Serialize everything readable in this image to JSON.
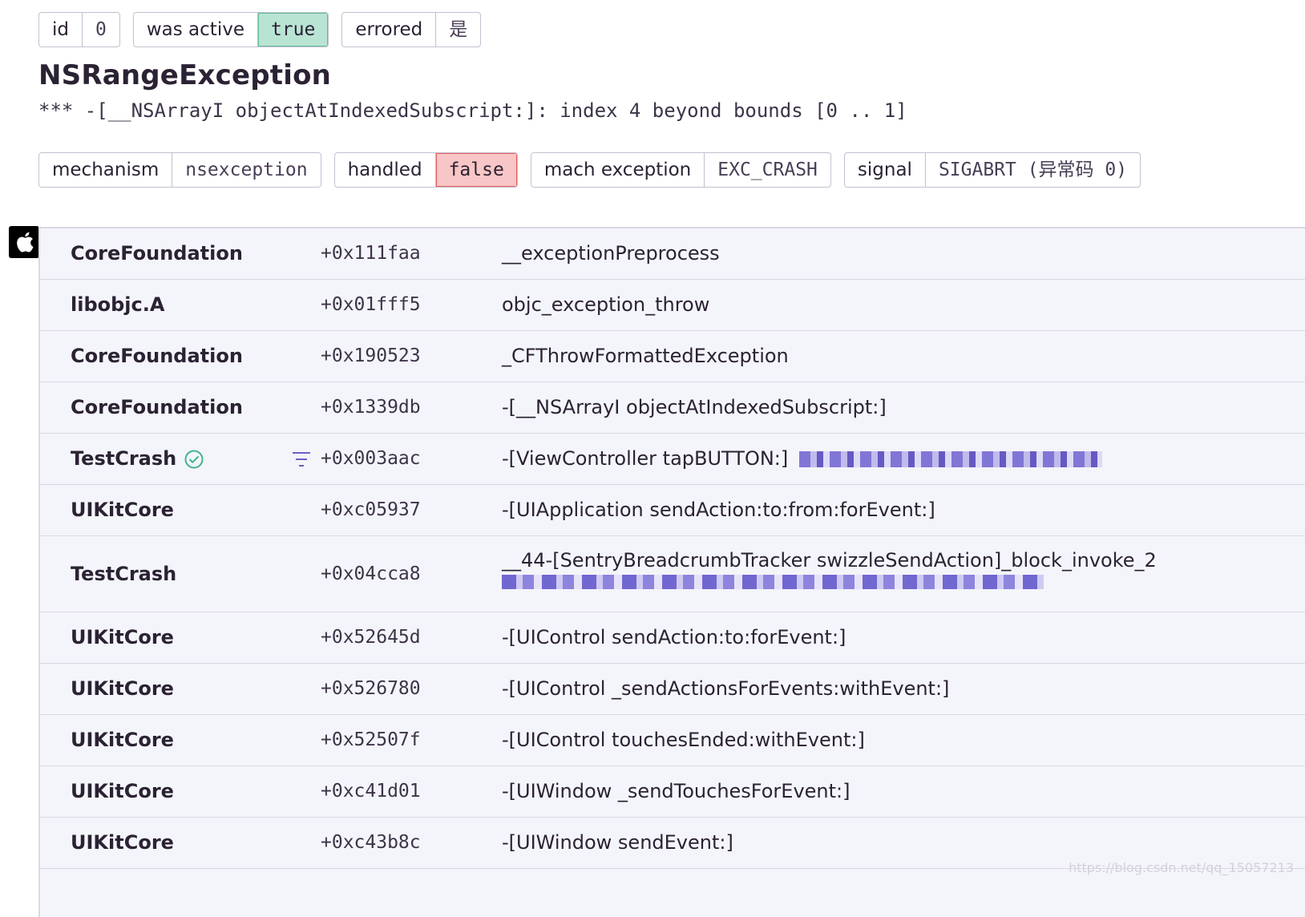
{
  "tags_top": [
    {
      "key": "id",
      "value": "0",
      "variant": "default"
    },
    {
      "key": "was active",
      "value": "true",
      "variant": "success"
    },
    {
      "key": "errored",
      "value": "是",
      "variant": "default"
    }
  ],
  "exception": {
    "type": "NSRangeException",
    "value": "*** -[__NSArrayI objectAtIndexedSubscript:]: index 4 beyond bounds [0 .. 1]"
  },
  "mechanism_tags": [
    {
      "key": "mechanism",
      "value": "nsexception",
      "variant": "default"
    },
    {
      "key": "handled",
      "value": "false",
      "variant": "danger"
    },
    {
      "key": "mach exception",
      "value": "EXC_CRASH",
      "variant": "default"
    },
    {
      "key": "signal",
      "value": "SIGABRT (异常码 0)",
      "variant": "default"
    }
  ],
  "platform_icon": "apple-icon",
  "frames": [
    {
      "package": "CoreFoundation",
      "address": "+0x111faa",
      "function": "__exceptionPreprocess"
    },
    {
      "package": "libobjc.A",
      "address": "+0x01fff5",
      "function": "objc_exception_throw"
    },
    {
      "package": "CoreFoundation",
      "address": "+0x190523",
      "function": "_CFThrowFormattedException"
    },
    {
      "package": "CoreFoundation",
      "address": "+0x1339db",
      "function": "-[__NSArrayI objectAtIndexedSubscript:]"
    },
    {
      "package": "TestCrash",
      "address": "+0x003aac",
      "function": "-[ViewController tapBUTTON:]",
      "in_app": true
    },
    {
      "package": "UIKitCore",
      "address": "+0xc05937",
      "function": "-[UIApplication sendAction:to:from:forEvent:]"
    },
    {
      "package": "TestCrash",
      "address": "+0x04cca8",
      "function": "__44-[SentryBreadcrumbTracker swizzleSendAction]_block_invoke_2"
    },
    {
      "package": "UIKitCore",
      "address": "+0x52645d",
      "function": "-[UIControl sendAction:to:forEvent:]"
    },
    {
      "package": "UIKitCore",
      "address": "+0x526780",
      "function": "-[UIControl _sendActionsForEvents:withEvent:]"
    },
    {
      "package": "UIKitCore",
      "address": "+0x52507f",
      "function": "-[UIControl touchesEnded:withEvent:]"
    },
    {
      "package": "UIKitCore",
      "address": "+0xc41d01",
      "function": "-[UIWindow _sendTouchesForEvent:]"
    },
    {
      "package": "UIKitCore",
      "address": "+0xc43b8c",
      "function": "-[UIWindow sendEvent:]"
    }
  ],
  "watermark": "https://blog.csdn.net/qq_15057213"
}
